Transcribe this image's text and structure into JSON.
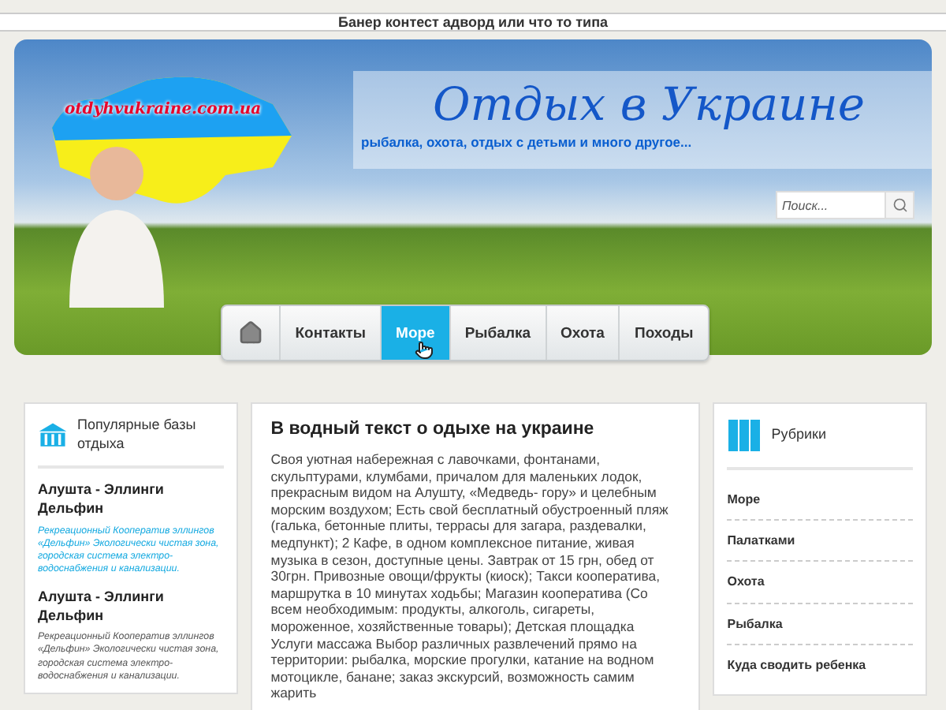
{
  "banner": {
    "text": "Банер контест адворд или что то типа"
  },
  "header": {
    "logo": "otdyhvukraine.com.ua",
    "title": "Отдых в Украине",
    "tagline": "рыбалка, охота, отдых с детьми и много другое...",
    "search": {
      "placeholder": "Поиск..."
    }
  },
  "nav": [
    {
      "label": "Контакты",
      "selected": false
    },
    {
      "label": "Море",
      "selected": true
    },
    {
      "label": "Рыбалка",
      "selected": false
    },
    {
      "label": "Охота",
      "selected": false
    },
    {
      "label": "Походы",
      "selected": false
    }
  ],
  "left_panel": {
    "title": "Популярные базы отдыха",
    "items": [
      {
        "title": "Алушта - Эллинги Дельфин",
        "text": "Рекреационный Кооператив эллингов «Дельфин» Экологически чистая зона, городская система электро- водоснабжения и канализации.",
        "highlighted": true
      },
      {
        "title": "Алушта - Эллинги Дельфин",
        "text": "Рекреационный Кооператив эллингов «Дельфин» Экологически чистая зона, городская система электро- водоснабжения и канализации.",
        "highlighted": false
      }
    ]
  },
  "main": {
    "title": "В водный текст о одыхе на украине",
    "body": "Своя уютная набережная с лавочками, фонтанами, скульптурами, клумбами, причалом для маленьких лодок, прекрасным видом на Алушту, «Медведь- гору» и целебным морским воздухом; Есть свой бесплатный обустроенный пляж (галька, бетонные плиты, террасы для загара, раздевалки, медпункт); 2 Кафе, в одном комплексное питание, живая музыка в сезон, доступные цены. Завтрак от 15 грн, обед от 30грн. Привозные овощи/фрукты (киоск); Такси кооператива, маршрутка в 10 минутах ходьбы; Магазин кооператива (Со всем необходимым: продукты, алкоголь, сигареты, мороженное, хозяйственные товары); Детская площадка Услуги массажа Выбор различных развлечений прямо на территории: рыбалка, морские прогулки, катание на водном мотоцикле, банане; заказ экскурсий, возможность самим жарить"
  },
  "right_panel": {
    "title": "Рубрики",
    "items": [
      "Море",
      "Палатками",
      "Охота",
      "Рыбалка",
      "Куда сводить ребенка"
    ]
  }
}
